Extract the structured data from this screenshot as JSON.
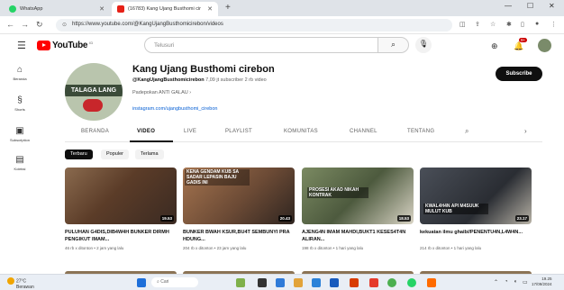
{
  "browser": {
    "tabs": [
      {
        "label": "WhatsApp"
      },
      {
        "label": "(16783) Kang Ujang Busthomi cir"
      }
    ],
    "new_tab": "+",
    "url": "https://www.youtube.com/@KangUjangBusthomicirebon/videos"
  },
  "masthead": {
    "logo_text": "YouTube",
    "logo_country": "ID",
    "search_placeholder": "Telusuri",
    "notification_count": "9+"
  },
  "rail": [
    {
      "label": "Beranda",
      "icon": "home-icon"
    },
    {
      "label": "Shorts",
      "icon": "shorts-icon"
    },
    {
      "label": "Subscription",
      "icon": "subscriptions-icon"
    },
    {
      "label": "Koleksi",
      "icon": "library-icon"
    }
  ],
  "channel": {
    "avatar_text": "TALAGA LANG",
    "name": "Kang Ujang Busthomi cirebon",
    "handle": "@KangUjangBusthomicirebon",
    "stats": "7,09 jt subscriber  2 rb video",
    "description": "Padepokan ANTI GALAU",
    "link": "instagram.com/ujangbusthomi_cirebon",
    "subscribe_label": "Subscribe"
  },
  "channel_tabs": [
    {
      "label": "BERANDA",
      "active": false
    },
    {
      "label": "VIDEO",
      "active": true
    },
    {
      "label": "LIVE",
      "active": false
    },
    {
      "label": "PLAYLIST",
      "active": false
    },
    {
      "label": "KOMUNITAS",
      "active": false
    },
    {
      "label": "CHANNEL",
      "active": false
    },
    {
      "label": "TENTANG",
      "active": false
    }
  ],
  "chips": [
    {
      "label": "Terbaru",
      "selected": true
    },
    {
      "label": "Populer",
      "selected": false
    },
    {
      "label": "Terlama",
      "selected": false
    }
  ],
  "videos": [
    {
      "title": "PULUHAN G4DIS,DIB4W4H BUNKER DIRMH PENGIKUT IMAM...",
      "meta": "46 rb x ditonton • 2 jam yang lalu",
      "duration": "19.53",
      "overlay": "",
      "bg": "#6b4a35"
    },
    {
      "title": "BUNKER BWAH KSUR,BU4T SEMBUNYI PRA HDUNG...",
      "meta": "204 rb x ditonton • 23 jam yang lalu",
      "duration": "20.43",
      "overlay": "KENA GENDAM KUB SA SADAR LEPASIN BAJU GADIS INI",
      "bg": "#8a5a3b"
    },
    {
      "title": "AJENG4N IMAM MAHDI,BUKT1 KESES4T4N ALIRAN...",
      "meta": "198 rb x ditonton • 1 hari yang lalu",
      "duration": "18.53",
      "overlay": "PROSESI AKAD NIKAH KONTRAK",
      "bg": "#4d5a3e"
    },
    {
      "title": "kekuatan ilmu ghaib//PENENTU4N,L4W4N...",
      "meta": "214 rb x ditonton • 1 hari yang lalu",
      "duration": "23.17",
      "overlay": "KWAL4H4N API M4SUUK MULUT KUB",
      "bg": "#2a2d33"
    }
  ],
  "taskbar": {
    "weather_temp": "27°C",
    "weather_desc": "Berawan",
    "search_placeholder": "Cari",
    "time": "19.25",
    "date": "17/09/2024"
  }
}
